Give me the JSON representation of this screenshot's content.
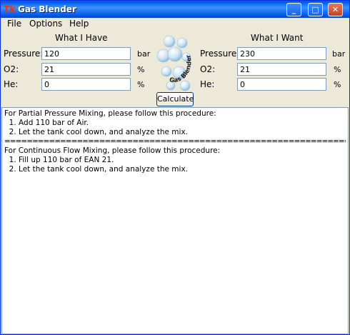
{
  "window": {
    "title": "Gas Blender",
    "app_icon": "Tk"
  },
  "menu": [
    "File",
    "Options",
    "Help"
  ],
  "have": {
    "header": "What I Have",
    "pressure": {
      "label": "Pressure:",
      "value": "120",
      "unit": "bar"
    },
    "o2": {
      "label": "O2:",
      "value": "21",
      "unit": "%"
    },
    "he": {
      "label": "He:",
      "value": "0",
      "unit": "%"
    }
  },
  "want": {
    "header": "What I Want",
    "pressure": {
      "label": "Pressure:",
      "value": "230",
      "unit": "bar"
    },
    "o2": {
      "label": "O2:",
      "value": "21",
      "unit": "%"
    },
    "he": {
      "label": "He:",
      "value": "0",
      "unit": "%"
    }
  },
  "logo_text": "Gas Blender",
  "calculate_label": "Calculate",
  "output": {
    "pp_intro": "For Partial Pressure Mixing, please follow this procedure:",
    "pp_steps": [
      "  1. Add 110 bar of Air.",
      "  2. Let the tank cool down, and analyze the mix."
    ],
    "separator": "=================================================================================================================",
    "cf_intro": "For Continuous Flow Mixing, please follow this procedure:",
    "cf_steps": [
      "  1. Fill up 110 bar of EAN 21.",
      "  2. Let the tank cool down, and analyze the mix."
    ]
  }
}
